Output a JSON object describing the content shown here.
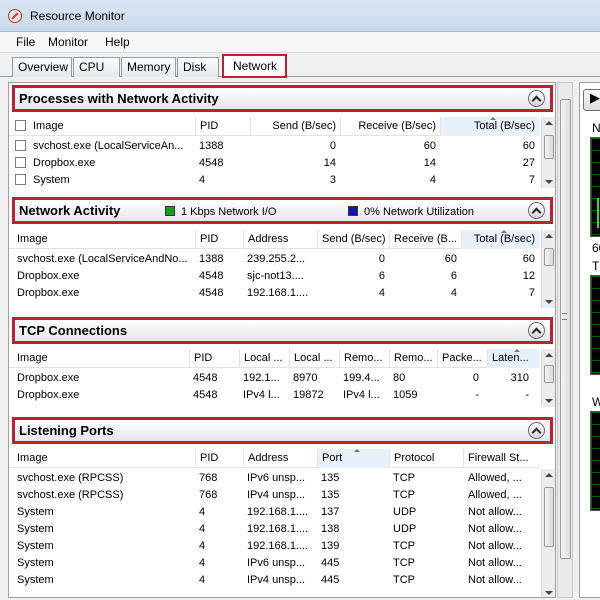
{
  "window": {
    "title": "Resource Monitor"
  },
  "menu": [
    "File",
    "Monitor",
    "Help"
  ],
  "tabs": [
    "Overview",
    "CPU",
    "Memory",
    "Disk",
    "Network"
  ],
  "right_panel": {
    "labels": [
      "N",
      "60",
      "T",
      "W"
    ]
  },
  "processes": {
    "title": "Processes with Network Activity",
    "columns": [
      "Image",
      "PID",
      "Send (B/sec)",
      "Receive (B/sec)",
      "Total (B/sec)"
    ],
    "rows": [
      [
        "svchost.exe (LocalServiceAn...",
        "1388",
        "0",
        "60",
        "60"
      ],
      [
        "Dropbox.exe",
        "4548",
        "14",
        "14",
        "27"
      ],
      [
        "System",
        "4",
        "3",
        "4",
        "7"
      ]
    ]
  },
  "network_activity": {
    "title": "Network Activity",
    "legend_io": "1 Kbps Network I/O",
    "legend_util": "0% Network Utilization",
    "colors": {
      "io": "#1e9a1e",
      "util": "#1414b4"
    },
    "columns": [
      "Image",
      "PID",
      "Address",
      "Send (B/sec)",
      "Receive (B...",
      "Total (B/sec)"
    ],
    "rows": [
      [
        "svchost.exe (LocalServiceAndNo...",
        "1388",
        "239.255.2...",
        "0",
        "60",
        "60"
      ],
      [
        "Dropbox.exe",
        "4548",
        "sjc-not13....",
        "6",
        "6",
        "12"
      ],
      [
        "Dropbox.exe",
        "4548",
        "192.168.1....",
        "4",
        "4",
        "7"
      ]
    ]
  },
  "tcp": {
    "title": "TCP Connections",
    "columns": [
      "Image",
      "PID",
      "Local ...",
      "Local ...",
      "Remo...",
      "Remo...",
      "Packe...",
      "Laten..."
    ],
    "rows": [
      [
        "Dropbox.exe",
        "4548",
        "192.1...",
        "8970",
        "199.4...",
        "80",
        "0",
        "310"
      ],
      [
        "Dropbox.exe",
        "4548",
        "IPv4 l...",
        "19872",
        "IPv4 l...",
        "1059",
        "-",
        "-"
      ]
    ]
  },
  "listening": {
    "title": "Listening Ports",
    "columns": [
      "Image",
      "PID",
      "Address",
      "Port",
      "Protocol",
      "Firewall St..."
    ],
    "rows": [
      [
        "svchost.exe (RPCSS)",
        "768",
        "IPv6 unsp...",
        "135",
        "TCP",
        "Allowed, ..."
      ],
      [
        "svchost.exe (RPCSS)",
        "768",
        "IPv4 unsp...",
        "135",
        "TCP",
        "Allowed, ..."
      ],
      [
        "System",
        "4",
        "192.168.1....",
        "137",
        "UDP",
        "Not allow..."
      ],
      [
        "System",
        "4",
        "192.168.1....",
        "138",
        "UDP",
        "Not allow..."
      ],
      [
        "System",
        "4",
        "192.168.1....",
        "139",
        "TCP",
        "Not allow..."
      ],
      [
        "System",
        "4",
        "IPv6 unsp...",
        "445",
        "TCP",
        "Not allow..."
      ],
      [
        "System",
        "4",
        "IPv4 unsp...",
        "445",
        "TCP",
        "Not allow..."
      ]
    ]
  }
}
